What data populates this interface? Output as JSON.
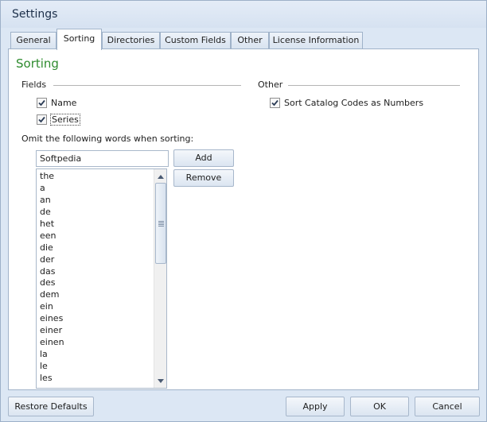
{
  "window": {
    "title": "Settings"
  },
  "tabs": [
    {
      "label": "General",
      "active": false
    },
    {
      "label": "Sorting",
      "active": true
    },
    {
      "label": "Directories",
      "active": false
    },
    {
      "label": "Custom Fields",
      "active": false
    },
    {
      "label": "Other",
      "active": false
    },
    {
      "label": "License Information",
      "active": false
    }
  ],
  "sorting": {
    "title": "Sorting",
    "fields_label": "Fields",
    "other_label": "Other",
    "fields": [
      {
        "label": "Name",
        "checked": true
      },
      {
        "label": "Series",
        "checked": true
      }
    ],
    "other_options": [
      {
        "label": "Sort Catalog Codes as Numbers",
        "checked": true
      }
    ],
    "omit_label": "Omit the following words when sorting:",
    "word_input_value": "Softpedia",
    "add_label": "Add",
    "remove_label": "Remove",
    "omit_words": [
      "the",
      "a",
      "an",
      "de",
      "het",
      "een",
      "die",
      "der",
      "das",
      "des",
      "dem",
      "ein",
      "eines",
      "einer",
      "einen",
      "la",
      "le",
      "les"
    ]
  },
  "footer": {
    "restore_defaults_label": "Restore Defaults",
    "apply_label": "Apply",
    "ok_label": "OK",
    "cancel_label": "Cancel"
  },
  "colors": {
    "accent_green": "#2e8b2e",
    "window_background": "#dce7f4",
    "panel_background": "#ffffff"
  }
}
